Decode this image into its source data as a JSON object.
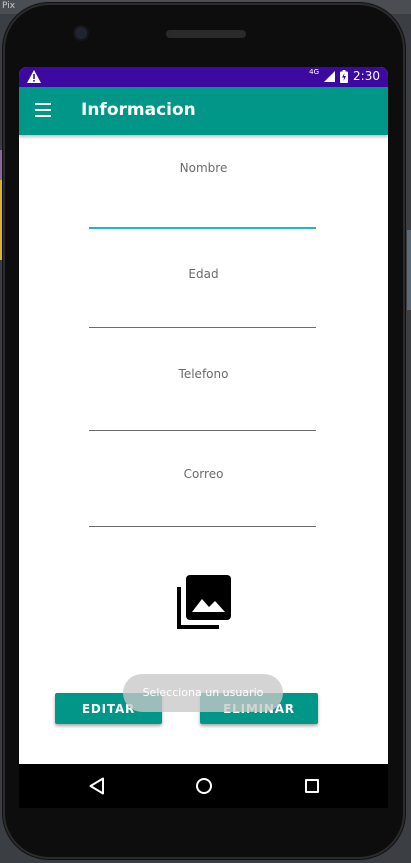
{
  "ide": {
    "title": "Pix"
  },
  "statusbar": {
    "network": "4G",
    "time": "2:30"
  },
  "appbar": {
    "title": "Informacion"
  },
  "form": {
    "nombre_label": "Nombre",
    "edad_label": "Edad",
    "telefono_label": "Telefono",
    "correo_label": "Correo",
    "nombre_value": "",
    "edad_value": "",
    "telefono_value": "",
    "correo_value": ""
  },
  "buttons": {
    "editar": "EDITAR",
    "eliminar": "ELIMINAR"
  },
  "toast": {
    "text": "Selecciona un usuario"
  },
  "colors": {
    "status_bar": "#3c0aa0",
    "primary": "#009688",
    "focus_underline": "#26b5c8"
  },
  "icons": [
    "warning-icon",
    "battery-icon",
    "signal-icon",
    "menu-icon",
    "photo-library-icon",
    "back-icon",
    "home-icon",
    "recents-icon"
  ]
}
